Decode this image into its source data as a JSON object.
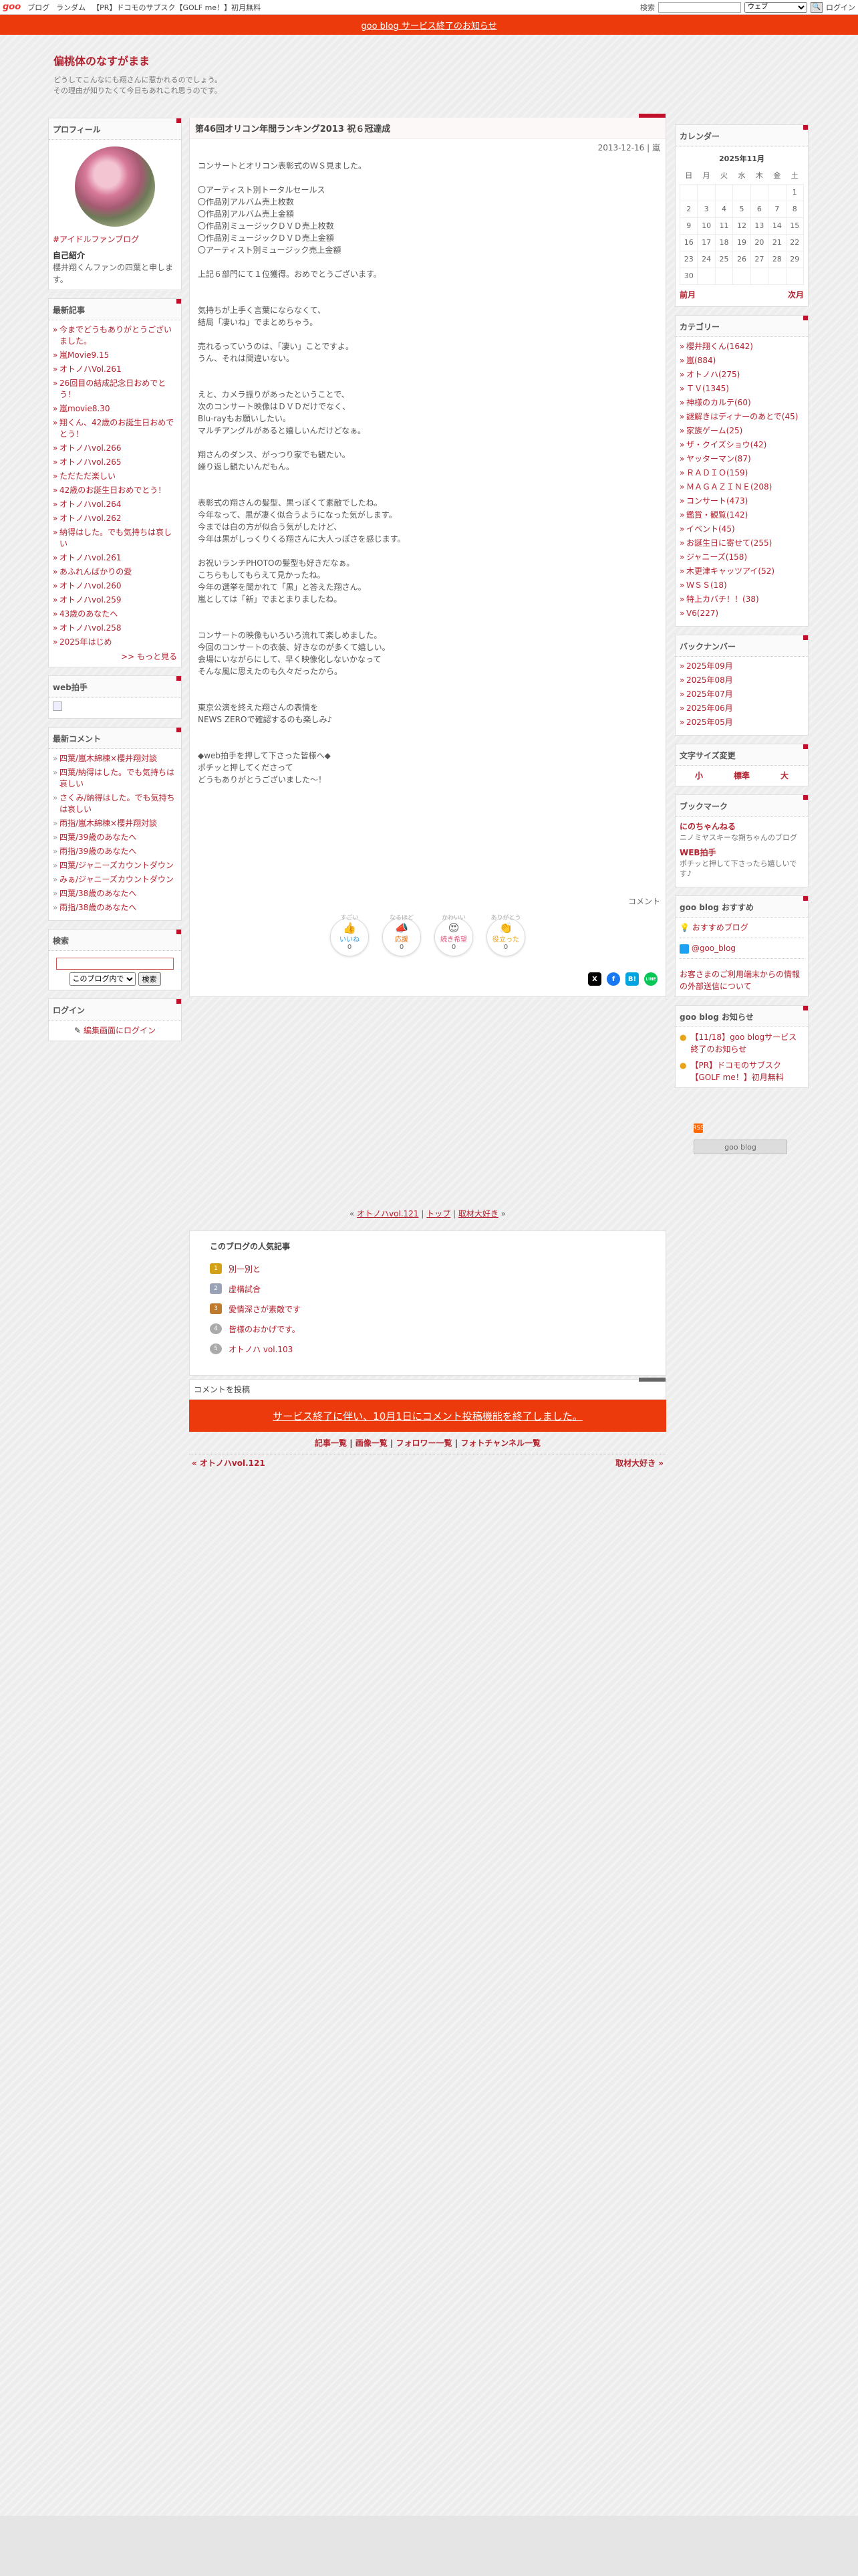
{
  "topbar": {
    "logo": "goo",
    "links": [
      "ブログ",
      "ランダム",
      "【PR】ドコモのサブスク【GOLF me！】初月無料"
    ],
    "search_label": "検索",
    "search_scope": "ウェブ",
    "login": "ログイン"
  },
  "notice": "goo blog サービス終了のお知らせ",
  "blog": {
    "title": "偏桃体のなすがまま",
    "desc1": "どうしてこんなにも翔さんに惹かれるのでしょう。",
    "desc2": "その理由が知りたくて今日もあれこれ思うのです。"
  },
  "profile": {
    "header": "プロフィール",
    "link": "#アイドルファンブログ",
    "intro_title": "自己紹介",
    "intro": "櫻井翔くんファンの四葉と申します。"
  },
  "recent": {
    "header": "最新記事",
    "items": [
      "今までどうもありがとうございました。",
      "嵐Movie9.15",
      "オトノハVol.261",
      "26回目の結成記念日おめでとう！",
      "嵐movie8.30",
      "翔くん、42歳のお誕生日おめでとう！",
      "オトノハvol.266",
      "オトノハvol.265",
      "ただただ楽しい",
      "42歳のお誕生日おめでとう！",
      "オトノハvol.264",
      "オトノハvol.262",
      "納得はした。でも気持ちは哀しい",
      "オトノハvol.261",
      "あふれんばかりの愛",
      "オトノハvol.260",
      "オトノハvol.259",
      "43歳のあなたへ",
      "オトノハvol.258",
      "2025年はじめ"
    ],
    "more": ">> もっと見る"
  },
  "webclap": {
    "header": "web拍手"
  },
  "comments": {
    "header": "最新コメント",
    "items": [
      "四葉/嵐木綿棟×櫻井翔対談",
      "四葉/納得はした。でも気持ちは哀しい",
      "さくみ/納得はした。でも気持ちは哀しい",
      "雨指/嵐木綿棟×櫻井翔対談",
      "四葉/39歳のあなたへ",
      "雨指/39歳のあなたへ",
      "四葉/ジャニーズカウントダウン",
      "みぁ/ジャニーズカウントダウン",
      "四葉/38歳のあなたへ",
      "雨指/38歳のあなたへ"
    ]
  },
  "search": {
    "header": "検索",
    "scope": "このブログ内で",
    "button": "検索"
  },
  "login": {
    "header": "ログイン",
    "link": "編集画面にログイン"
  },
  "entry": {
    "title": "第46回オリコン年間ランキング2013 祝６冠達成",
    "date": "2013-12-16",
    "category": "嵐",
    "body": "コンサートとオリコン表彰式のＷＳ見ました。\n\n〇アーティスト別トータルセールス\n〇作品別アルバム売上枚数\n〇作品別アルバム売上金額\n〇作品別ミュージックＤＶＤ売上枚数\n〇作品別ミュージックＤＶＤ売上金額\n〇アーティスト別ミュージック売上金額\n\n上記６部門にて１位獲得。おめでとうございます。\n\n\n気持ちが上手く言葉にならなくて、\n結局「凄いね」でまとめちゃう。\n\n売れるっていうのは、「凄い」ことですよ。\nうん、それは間違いない。\n\n\nえと、カメラ振りがあったということで、\n次のコンサート映像はＤＶＤだけでなく、\nBlu-rayもお願いしたい。\nマルチアングルがあると嬉しいんだけどなぁ。\n\n翔さんのダンス、がっつり家でも観たい。\n繰り返し観たいんだもん。\n\n\n表彰式の翔さんの髪型、黒っぽくて素敵でしたね。\n今年なって、黒が凄く似合うようになった気がします。\n今までは白の方が似合う気がしたけど、\n今年は黒がしっくりくる翔さんに大人っぽさを感じます。\n\nお祝いランチPHOTOの髪型も好きだなぁ。\nこちらもしてもらえて見かったね。\n今年の選挙を聞かれて「黒」と答えた翔さん。\n嵐としては「新」でまとまりましたね。\n\n\nコンサートの映像もいろいろ流れて楽しめました。\n今回のコンサートの衣装、好きなのが多くて嬉しい。\n会場にいながらにして、早く映像化しないかなって\nそんな風に思えたのも久々だったから。\n\n\n東京公演を終えた翔さんの表情を\nNEWS ZEROで確認するのも楽しみ♪\n\n\n◆web拍手を押して下さった皆様へ◆\nポチッと押してくださって\nどうもありがとうございました～！",
    "comment_link": "コメント",
    "reactions": [
      {
        "title": "すごい",
        "label": "いいね",
        "count": "0",
        "emoji": "👍"
      },
      {
        "title": "なるほど",
        "label": "応援",
        "count": "0",
        "emoji": "📣"
      },
      {
        "title": "かわいい",
        "label": "続き希望",
        "count": "0",
        "emoji": "😍"
      },
      {
        "title": "ありがとう",
        "label": "役立った",
        "count": "0",
        "emoji": "👏"
      }
    ],
    "share": [
      "X",
      "f",
      "B!",
      "LINE"
    ]
  },
  "pager": {
    "prev": "オトノハvol.121",
    "top": "トップ",
    "next": "取材大好き"
  },
  "popular": {
    "header": "このブログの人気記事",
    "items": [
      "別一別と",
      "虚構試合",
      "愛情深さが素敵です",
      "皆様のおかげです。",
      "オトノハ vol.103"
    ],
    "ranks": [
      "1",
      "2",
      "3",
      "4",
      "5"
    ]
  },
  "post": {
    "header": "コメントを投稿",
    "closed": "サービス終了に伴い、10月1日にコメント投稿機能を終了しました。",
    "links": [
      "記事一覧",
      "画像一覧",
      "フォロワー一覧",
      "フォトチャンネル一覧"
    ],
    "prev": "« オトノハvol.121",
    "next": "取材大好き »"
  },
  "calendar": {
    "header": "カレンダー",
    "month": "2025年11月",
    "days": [
      "日",
      "月",
      "火",
      "水",
      "木",
      "金",
      "土"
    ],
    "weeks": [
      [
        "",
        "",
        "",
        "",
        "",
        "",
        "1"
      ],
      [
        "2",
        "3",
        "4",
        "5",
        "6",
        "7",
        "8"
      ],
      [
        "9",
        "10",
        "11",
        "12",
        "13",
        "14",
        "15"
      ],
      [
        "16",
        "17",
        "18",
        "19",
        "20",
        "21",
        "22"
      ],
      [
        "23",
        "24",
        "25",
        "26",
        "27",
        "28",
        "29"
      ],
      [
        "30",
        "",
        "",
        "",
        "",
        "",
        ""
      ]
    ],
    "prev": "前月",
    "next": "次月"
  },
  "categories": {
    "header": "カテゴリー",
    "items": [
      "櫻井翔くん(1642)",
      "嵐(884)",
      "オトノハ(275)",
      "ＴＶ(1345)",
      "神様のカルテ(60)",
      "謎解きはディナーのあとで(45)",
      "家族ゲーム(25)",
      "ザ・クイズショウ(42)",
      "ヤッターマン(87)",
      "ＲＡＤＩＯ(159)",
      "ＭＡＧＡＺＩＮＥ(208)",
      "コンサート(473)",
      "鑑賞・観覧(142)",
      "イベント(45)",
      "お誕生日に寄せて(255)",
      "ジャニーズ(158)",
      "木更津キャッツアイ(52)",
      "ＷＳＳ(18)",
      "特上カバチ！！(38)",
      "V6(227)"
    ]
  },
  "backnumber": {
    "header": "バックナンバー",
    "items": [
      "2025年09月",
      "2025年08月",
      "2025年07月",
      "2025年06月",
      "2025年05月"
    ]
  },
  "fontsize": {
    "header": "文字サイズ変更",
    "small": "小",
    "mid": "標準",
    "large": "大"
  },
  "bookmark": {
    "header": "ブックマーク",
    "items": [
      {
        "name": "にのちゃんねる",
        "desc": "ニノミヤスキーな朔ちゃんのブログ"
      },
      {
        "name": "WEB拍手",
        "desc": "ポチッと押して下さったら嬉しいです♪"
      }
    ]
  },
  "recommend": {
    "header": "goo blog おすすめ",
    "link1": "おすすめブログ",
    "link2": "@goo_blog",
    "note": "お客さまのご利用端末からの情報の外部送信について"
  },
  "info": {
    "header": "goo blog お知らせ",
    "items": [
      "【11/18】goo blogサービス終了のお知らせ",
      "【PR】ドコモのサブスク【GOLF me！】初月無料"
    ]
  },
  "rss": {
    "badge": "RSS",
    "button": "goo blog"
  },
  "colors": {
    "accent": "#c0102b",
    "notice": "#ec3a0c",
    "link": "#b3232f"
  }
}
